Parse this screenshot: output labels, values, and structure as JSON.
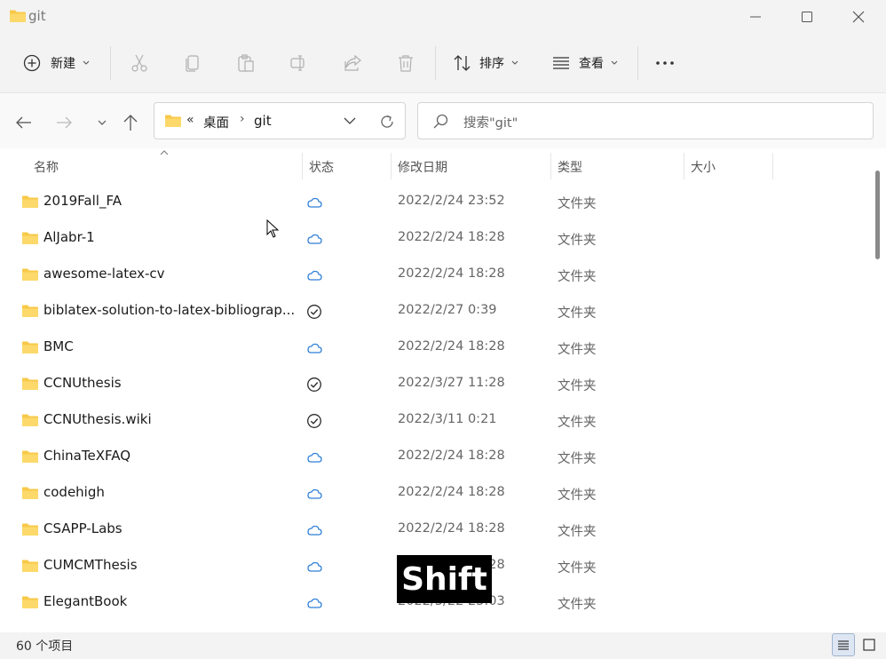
{
  "window": {
    "title": "git"
  },
  "toolbar": {
    "new_label": "新建",
    "sort_label": "排序",
    "view_label": "查看"
  },
  "address": {
    "overflow": "«",
    "parent": "桌面",
    "separator": "›",
    "current": "git"
  },
  "search": {
    "placeholder": "搜索\"git\""
  },
  "columns": {
    "name": "名称",
    "status": "状态",
    "modified": "修改日期",
    "type": "类型",
    "size": "大小"
  },
  "files": [
    {
      "name": "2019Fall_FA",
      "status": "cloud",
      "modified": "2022/2/24 23:52",
      "type": "文件夹"
    },
    {
      "name": "AlJabr-1",
      "status": "cloud",
      "modified": "2022/2/24 18:28",
      "type": "文件夹"
    },
    {
      "name": "awesome-latex-cv",
      "status": "cloud",
      "modified": "2022/2/24 18:28",
      "type": "文件夹"
    },
    {
      "name": "biblatex-solution-to-latex-bibliograp...",
      "status": "check",
      "modified": "2022/2/27 0:39",
      "type": "文件夹"
    },
    {
      "name": "BMC",
      "status": "cloud",
      "modified": "2022/2/24 18:28",
      "type": "文件夹"
    },
    {
      "name": "CCNUthesis",
      "status": "check",
      "modified": "2022/3/27 11:28",
      "type": "文件夹"
    },
    {
      "name": "CCNUthesis.wiki",
      "status": "check",
      "modified": "2022/3/11 0:21",
      "type": "文件夹"
    },
    {
      "name": "ChinaTeXFAQ",
      "status": "cloud",
      "modified": "2022/2/24 18:28",
      "type": "文件夹"
    },
    {
      "name": "codehigh",
      "status": "cloud",
      "modified": "2022/2/24 18:28",
      "type": "文件夹"
    },
    {
      "name": "CSAPP-Labs",
      "status": "cloud",
      "modified": "2022/2/24 18:28",
      "type": "文件夹"
    },
    {
      "name": "CUMCMThesis",
      "status": "cloud",
      "modified": "2022/2/24 18:28",
      "type": "文件夹"
    },
    {
      "name": "ElegantBook",
      "status": "cloud",
      "modified": "2022/3/22 23:03",
      "type": "文件夹"
    }
  ],
  "statusbar": {
    "count": "60 个项目"
  },
  "overlay": {
    "key": "Shift"
  },
  "colors": {
    "folder": "#f8c94a",
    "cloud": "#2f7fd6",
    "accent": "#1a73e8"
  }
}
